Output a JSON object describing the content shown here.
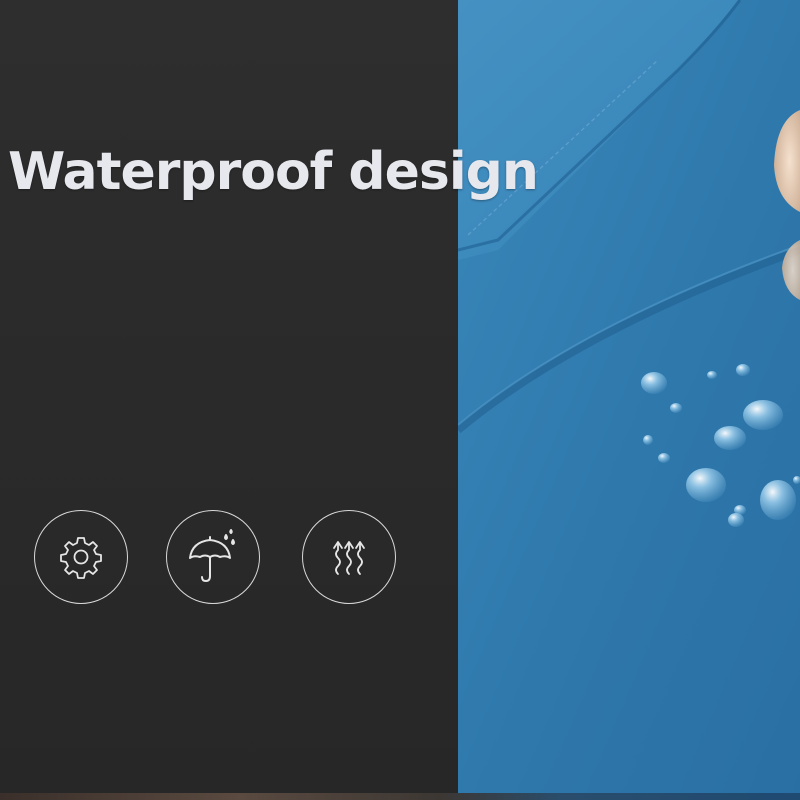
{
  "headline": "Waterproof design",
  "colors": {
    "dark_background": "#2b2b2b",
    "fabric_blue": "#2f79ad",
    "text": "#e7e8ee",
    "icon_stroke": "#e6e6e6"
  },
  "features": [
    {
      "icon": "gear-icon"
    },
    {
      "icon": "umbrella-rain-icon"
    },
    {
      "icon": "heat-wave-icon"
    }
  ]
}
